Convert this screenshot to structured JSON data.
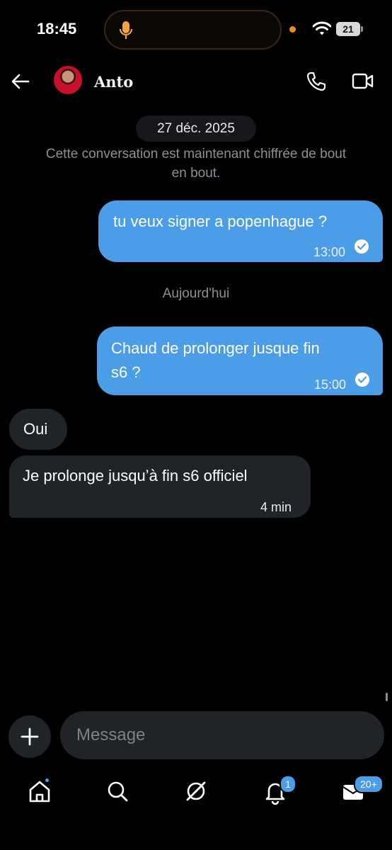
{
  "status_bar": {
    "time": "18:45",
    "battery": "21"
  },
  "header": {
    "back_icon": "arrow-left-icon",
    "contact_name": "Anto",
    "call_icon": "phone-icon",
    "video_icon": "video-camera-icon"
  },
  "conversation": {
    "date_pill": "27 déc. 2025",
    "system_note_line1": "Cette conversation est maintenant chiffrée de bout",
    "system_note_line2": "en bout.",
    "day_separator": "Aujourd'hui",
    "messages": [
      {
        "direction": "outgoing",
        "text": "tu veux signer a popenhague ?",
        "time": "13:00",
        "status": "read"
      },
      {
        "direction": "outgoing",
        "text_line1": "Chaud de prolonger jusque fin",
        "text_line2": "s6 ?",
        "time": "15:00",
        "status": "read"
      },
      {
        "direction": "incoming",
        "text": "Oui"
      },
      {
        "direction": "incoming",
        "text": "Je prolonge jusqu’à fin s6 officiel",
        "time": "4 min"
      }
    ]
  },
  "composer": {
    "placeholder": "Message",
    "plus_icon": "plus-icon"
  },
  "bottom_nav": {
    "items": [
      {
        "icon": "home-icon",
        "has_dot": true
      },
      {
        "icon": "search-icon"
      },
      {
        "icon": "grok-icon"
      },
      {
        "icon": "bell-icon",
        "badge": "1"
      },
      {
        "icon": "mail-icon",
        "badge": "20+"
      }
    ]
  },
  "colors": {
    "accent": "#4c9de8",
    "bubble_incoming": "#202327",
    "background": "#000000",
    "muted_text": "#8b9095"
  }
}
